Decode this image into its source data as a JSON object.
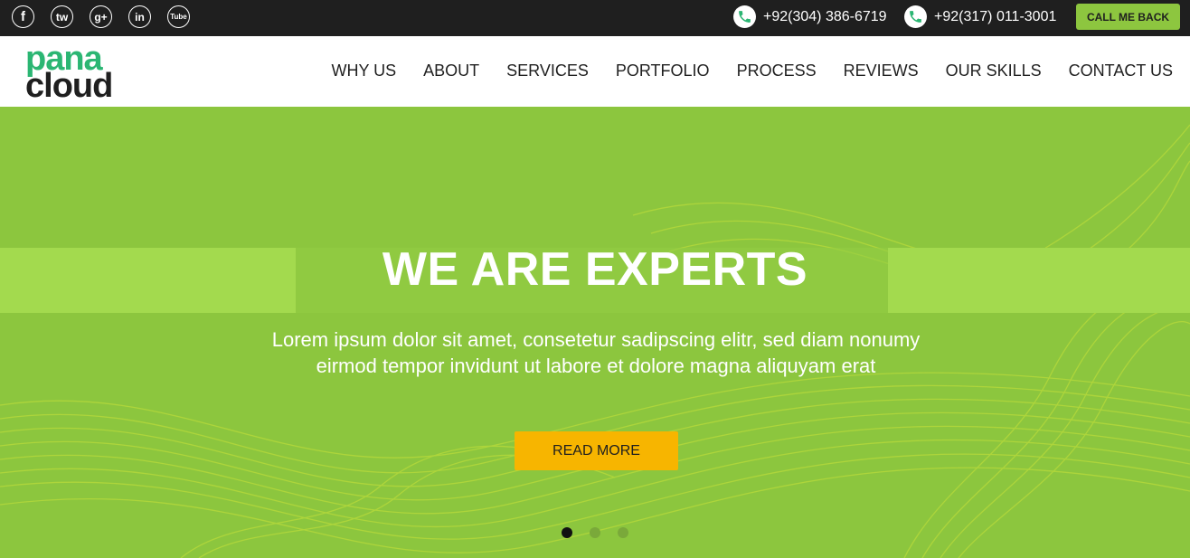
{
  "topbar": {
    "social": [
      {
        "icon": "facebook-icon",
        "glyph": "f"
      },
      {
        "icon": "twitter-icon",
        "glyph": "tw"
      },
      {
        "icon": "google-plus-icon",
        "glyph": "g+"
      },
      {
        "icon": "linkedin-icon",
        "glyph": "in"
      },
      {
        "icon": "youtube-icon",
        "glyph": "Tube"
      }
    ],
    "phones": [
      {
        "icon": "phone-icon",
        "number": "+92(304) 386-6719"
      },
      {
        "icon": "phone-icon",
        "number": "+92(317) 011-3001"
      }
    ],
    "callback_label": "CALL ME BACK"
  },
  "header": {
    "logo": {
      "line1": "pana",
      "line2": "cloud"
    },
    "nav": [
      "WHY US",
      "ABOUT",
      "SERVICES",
      "PORTFOLIO",
      "PROCESS",
      "REVIEWS",
      "OUR SKILLS",
      "CONTACT US"
    ]
  },
  "hero": {
    "title": "WE ARE EXPERTS",
    "text": "Lorem ipsum dolor sit amet, consetetur sadipscing elitr, sed diam nonumy eirmod tempor invidunt ut labore et dolore magna aliquyam erat",
    "button_label": "READ MORE",
    "slides": 3,
    "active_slide": 1
  },
  "colors": {
    "topbar_bg": "#1f1f1f",
    "accent_green": "#8dc63f",
    "hero_green": "#8cc63e",
    "button_yellow": "#f7b500",
    "logo_green": "#2bb673"
  }
}
